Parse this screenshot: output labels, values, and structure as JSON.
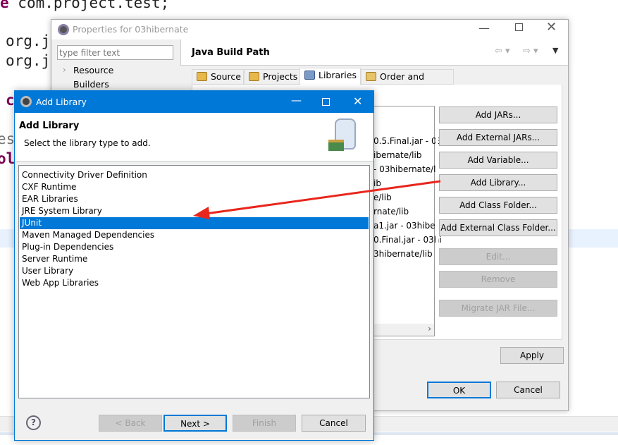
{
  "editor": {
    "line1_kw": "e",
    "line1": " com.project.test;",
    "line2": "org.j",
    "line3": "org.j",
    "line4_kw": "c",
    "line5": "es",
    "line6_kw": "ol"
  },
  "properties": {
    "title": "Properties for 03hibernate",
    "filter_placeholder": "type filter text",
    "tree": [
      {
        "label": "Resource",
        "expandable": true
      },
      {
        "label": "Builders",
        "expandable": false
      }
    ],
    "page_title": "Java Build Path",
    "tabs": [
      {
        "label": "Source"
      },
      {
        "label": "Projects"
      },
      {
        "label": "Libraries",
        "selected": true
      },
      {
        "label": "Order and Export"
      }
    ],
    "libraries_partial": [
      "0.5.Final.jar - 03",
      "ibernate/lib",
      "- 03hibernate/l",
      "ib",
      "e/lib",
      "rnate/lib",
      "a1.jar - 03hibe",
      "0.Final.jar - 03hi",
      "3hibernate/lib"
    ],
    "buttons": {
      "add_jars": "Add JARs...",
      "add_external_jars": "Add External JARs...",
      "add_variable": "Add Variable...",
      "add_library": "Add Library...",
      "add_class_folder": "Add Class Folder...",
      "add_external_class_folder": "Add External Class Folder...",
      "edit": "Edit...",
      "remove": "Remove",
      "migrate": "Migrate JAR File...",
      "apply": "Apply",
      "ok": "OK",
      "cancel": "Cancel"
    }
  },
  "add_library": {
    "title": "Add Library",
    "header_title": "Add Library",
    "header_subtitle": "Select the library type to add.",
    "items": [
      "Connectivity Driver Definition",
      "CXF Runtime",
      "EAR Libraries",
      "JRE System Library",
      "JUnit",
      "Maven Managed Dependencies",
      "Plug-in Dependencies",
      "Server Runtime",
      "User Library",
      "Web App Libraries"
    ],
    "selected": "JUnit",
    "buttons": {
      "back": "< Back",
      "next": "Next >",
      "finish": "Finish",
      "cancel": "Cancel"
    }
  },
  "colors": {
    "accent": "#0078d7",
    "annotation_arrow": "#e8261c"
  }
}
